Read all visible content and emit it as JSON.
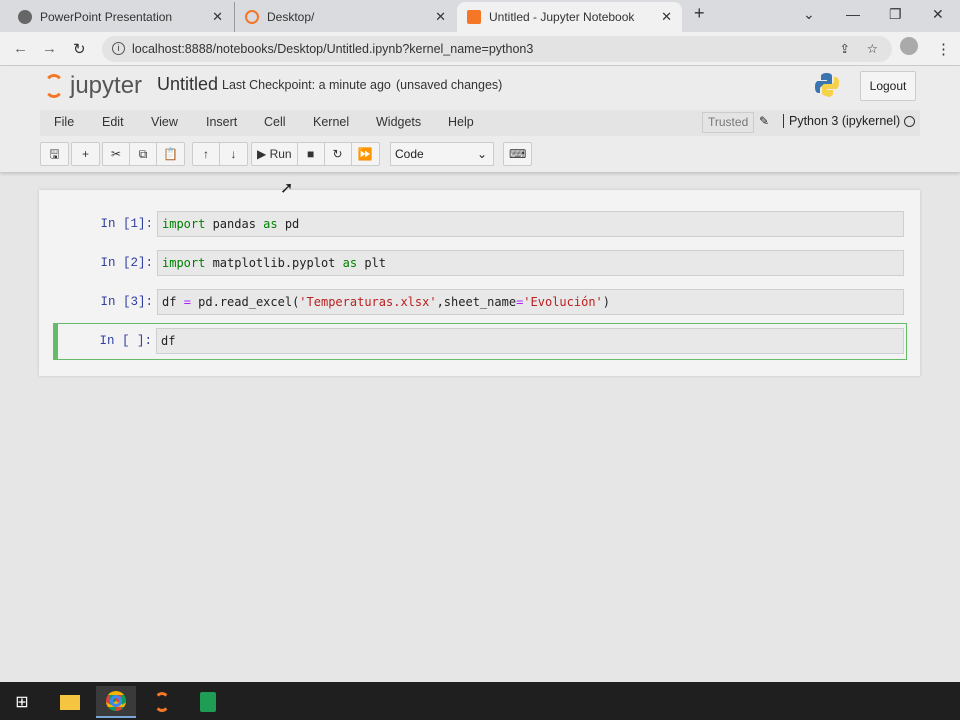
{
  "browser": {
    "tabs": [
      {
        "label": "PowerPoint Presentation"
      },
      {
        "label": "Desktop/"
      },
      {
        "label": "Untitled - Jupyter Notebook",
        "active": true
      }
    ],
    "url": "localhost:8888/notebooks/Desktop/Untitled.ipynb?kernel_name=python3"
  },
  "header": {
    "logo": "jupyter",
    "title": "Untitled",
    "checkpoint": "Last Checkpoint: a minute ago",
    "unsaved": "(unsaved changes)",
    "logout": "Logout"
  },
  "menubar": {
    "items": [
      "File",
      "Edit",
      "View",
      "Insert",
      "Cell",
      "Kernel",
      "Widgets",
      "Help"
    ],
    "trusted": "Trusted",
    "kernel": "Python 3 (ipykernel)"
  },
  "toolbar": {
    "run": "Run",
    "cell_type": "Code"
  },
  "cells": [
    {
      "prompt": "In [1]:",
      "tokens": [
        {
          "t": "import",
          "c": "kw"
        },
        {
          "t": " pandas "
        },
        {
          "t": "as",
          "c": "kw"
        },
        {
          "t": " pd"
        }
      ]
    },
    {
      "prompt": "In [2]:",
      "tokens": [
        {
          "t": "import",
          "c": "kw"
        },
        {
          "t": " matplotlib.pyplot "
        },
        {
          "t": "as",
          "c": "kw"
        },
        {
          "t": " plt"
        }
      ]
    },
    {
      "prompt": "In [3]:",
      "tokens": [
        {
          "t": "df "
        },
        {
          "t": "=",
          "c": "op"
        },
        {
          "t": " pd.read_excel("
        },
        {
          "t": "'Temperaturas.xlsx'",
          "c": "str"
        },
        {
          "t": ",sheet_name"
        },
        {
          "t": "=",
          "c": "op"
        },
        {
          "t": "'Evolución'",
          "c": "str"
        },
        {
          "t": ")"
        }
      ]
    },
    {
      "prompt": "In [ ]:",
      "tokens": [
        {
          "t": "df"
        }
      ],
      "selected": true
    }
  ]
}
